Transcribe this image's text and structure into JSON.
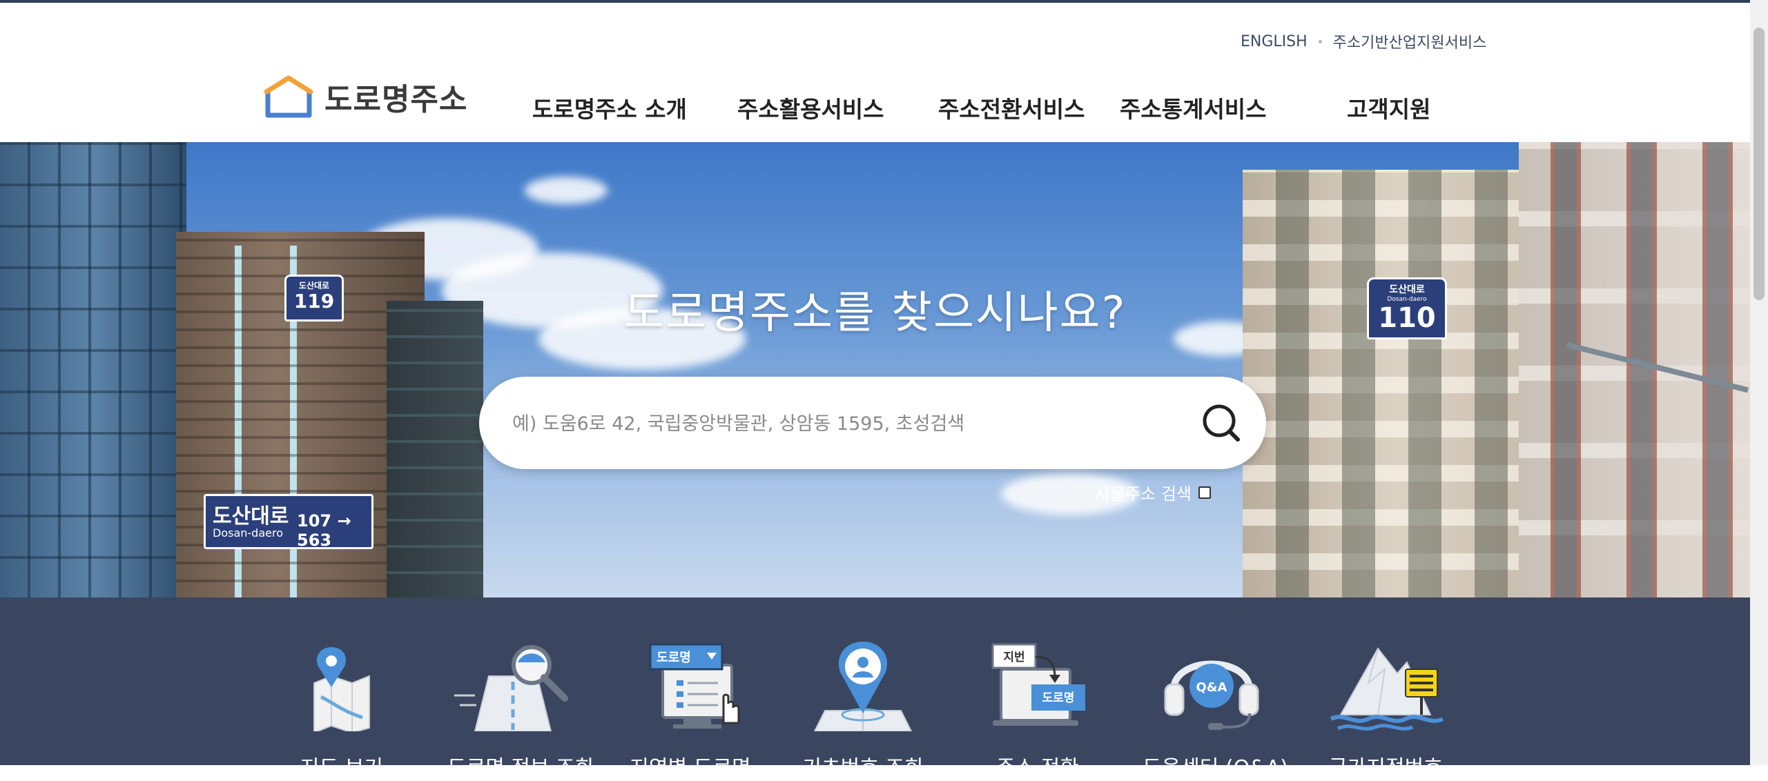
{
  "util_links": {
    "english": "ENGLISH",
    "industry": "주소기반산업지원서비스"
  },
  "logo": {
    "text": "도로명주소"
  },
  "gnb": [
    {
      "label": "도로명주소 소개"
    },
    {
      "label": "주소활용서비스"
    },
    {
      "label": "주소전환서비스"
    },
    {
      "label": "주소통계서비스"
    },
    {
      "label": "고객지원"
    }
  ],
  "hero": {
    "title": "도로명주소를 찾으시나요?",
    "search_placeholder": "예) 도움6로 42, 국립중앙박물관, 상암동 1595, 초성검색",
    "building_search_label": "사물주소 검색"
  },
  "signs": {
    "left_small_top": "도산대로",
    "left_small_num": "119",
    "left_big_name": "도산대로",
    "left_big_roman": "Dosan-daero",
    "left_big_range": "107 → 563",
    "right_top": "도산대로",
    "right_roman": "Dosan-daero",
    "right_num": "110"
  },
  "quick_menu": [
    {
      "label": "지도 보기",
      "icon": "map-icon"
    },
    {
      "label": "도로명 정보 조회",
      "icon": "road-search-icon"
    },
    {
      "label": "지역별 도로명",
      "icon": "regional-road-icon"
    },
    {
      "label": "기초번호 조회",
      "icon": "location-pin-icon"
    },
    {
      "label": "주소 전환",
      "icon": "address-convert-icon"
    },
    {
      "label": "도움센터 (Q&A)",
      "icon": "help-center-icon"
    },
    {
      "label": "국가지점번호",
      "icon": "national-point-icon"
    }
  ],
  "icon_texts": {
    "road_badge": "도로명",
    "jibun": "지번",
    "qa": "Q&A"
  },
  "colors": {
    "header_line": "#2f3e59",
    "quick_bar": "#3a4660",
    "accent_blue": "#4a90d9"
  }
}
